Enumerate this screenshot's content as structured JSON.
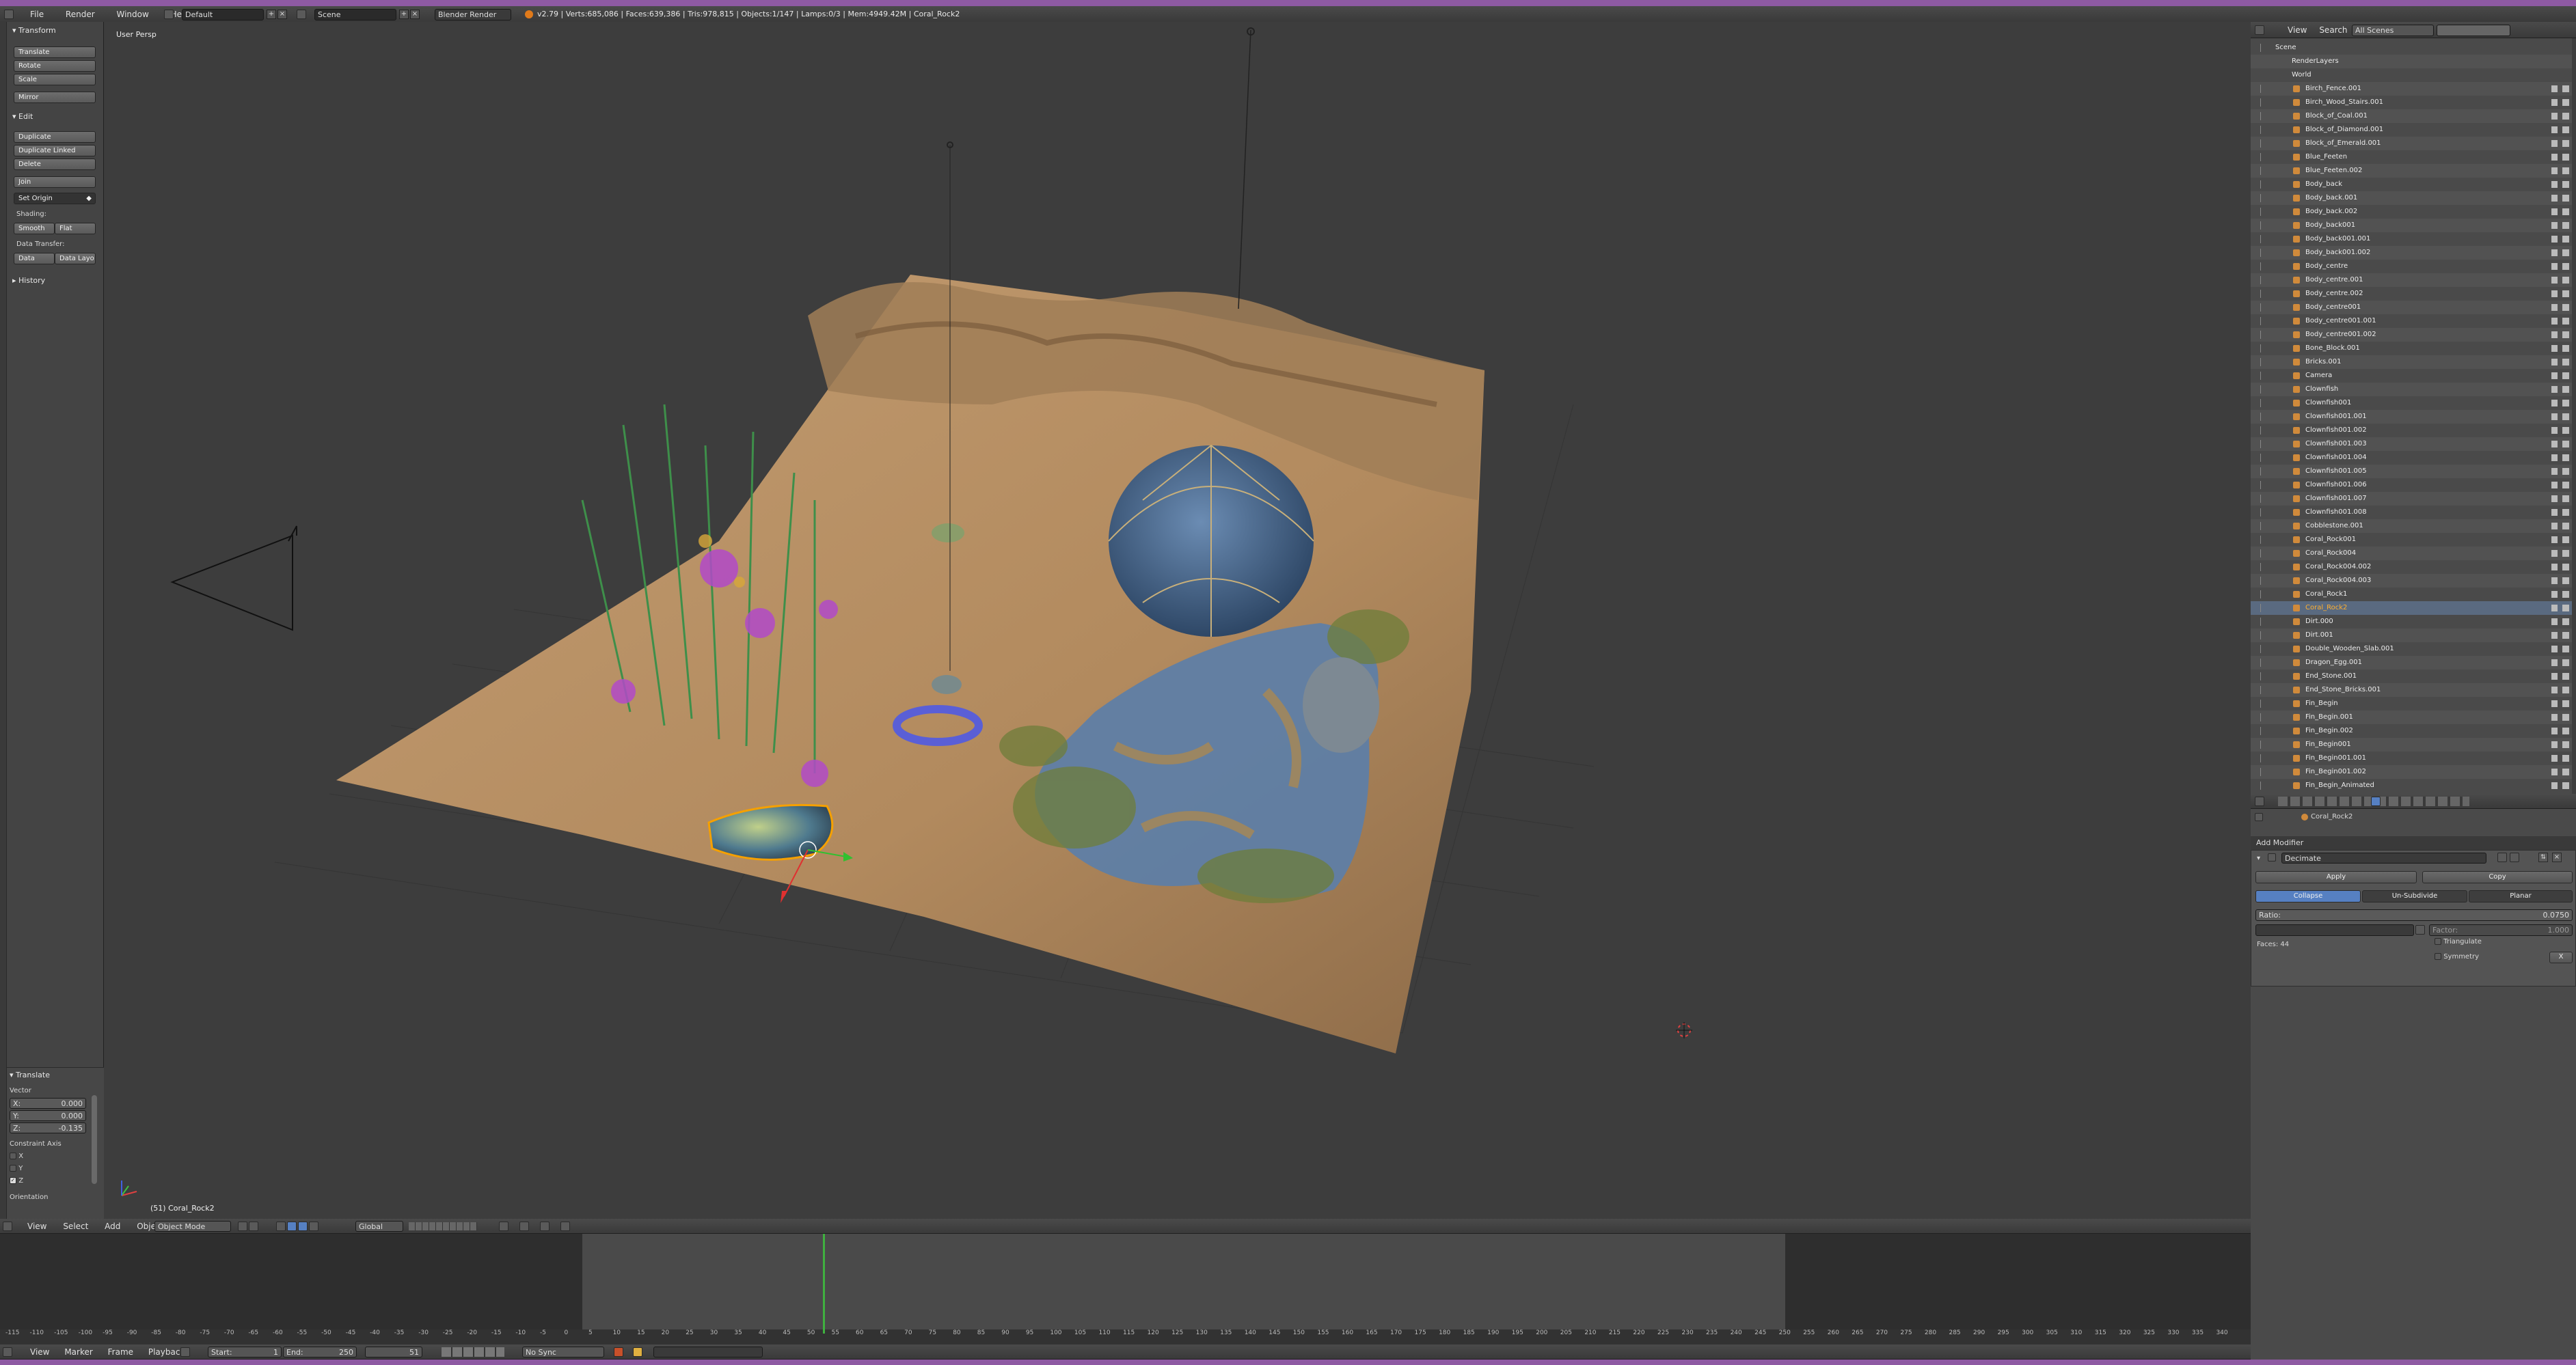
{
  "colors": {
    "accent_blue": "#5680c2",
    "purple_border": "#8e5aa3",
    "selected_orange": "#f5a000",
    "frame_green": "#3fb03f"
  },
  "topbar": {
    "menus": [
      "File",
      "Render",
      "Window",
      "Help"
    ],
    "layout": "Default",
    "scene": "Scene",
    "engine": "Blender Render",
    "stats": "v2.79 | Verts:685,086 | Faces:639,386 | Tris:978,815 | Objects:1/147 | Lamps:0/3 | Mem:4949.42M | Coral_Rock2"
  },
  "toolshelf": {
    "transform_title": "Transform",
    "transform_buttons": [
      "Translate",
      "Rotate",
      "Scale",
      "Mirror"
    ],
    "edit_title": "Edit",
    "edit_buttons": [
      "Duplicate",
      "Duplicate Linked",
      "Delete",
      "Join"
    ],
    "set_origin": "Set Origin",
    "shading_title": "Shading:",
    "shading_buttons": [
      "Smooth",
      "Flat"
    ],
    "data_transfer_title": "Data Transfer:",
    "data_transfer_buttons": [
      "Data",
      "Data Layo"
    ],
    "history_title": "History"
  },
  "operator_panel": {
    "title": "Translate",
    "vector_label": "Vector",
    "x": "X:",
    "x_val": "0.000",
    "y": "Y:",
    "y_val": "0.000",
    "z": "Z:",
    "z_val": "-0.135",
    "constraint_title": "Constraint Axis",
    "axes": [
      "X",
      "Y",
      "Z"
    ],
    "orientation_label": "Orientation"
  },
  "viewport": {
    "view_name": "User Persp",
    "object_label": "(51) Coral_Rock2"
  },
  "view3d_header": {
    "menus": [
      "View",
      "Select",
      "Add",
      "Object"
    ],
    "mode": "Object Mode",
    "orientation": "Global"
  },
  "outliner": {
    "menus": [
      "View",
      "Search"
    ],
    "scenes_dropdown": "All Scenes",
    "root": "Scene",
    "top_items": [
      "RenderLayers",
      "World"
    ],
    "items": [
      "Birch_Fence.001",
      "Birch_Wood_Stairs.001",
      "Block_of_Coal.001",
      "Block_of_Diamond.001",
      "Block_of_Emerald.001",
      "Blue_Feeten",
      "Blue_Feeten.002",
      "Body_back",
      "Body_back.001",
      "Body_back.002",
      "Body_back001",
      "Body_back001.001",
      "Body_back001.002",
      "Body_centre",
      "Body_centre.001",
      "Body_centre.002",
      "Body_centre001",
      "Body_centre001.001",
      "Body_centre001.002",
      "Bone_Block.001",
      "Bricks.001",
      "Camera",
      "Clownfish",
      "Clownfish001",
      "Clownfish001.001",
      "Clownfish001.002",
      "Clownfish001.003",
      "Clownfish001.004",
      "Clownfish001.005",
      "Clownfish001.006",
      "Clownfish001.007",
      "Clownfish001.008",
      "Cobblestone.001",
      "Coral_Rock001",
      "Coral_Rock004",
      "Coral_Rock004.002",
      "Coral_Rock004.003",
      "Coral_Rock1",
      "Coral_Rock2",
      "Dirt.000",
      "Dirt.001",
      "Double_Wooden_Slab.001",
      "Dragon_Egg.001",
      "End_Stone.001",
      "End_Stone_Bricks.001",
      "Fin_Begin",
      "Fin_Begin.001",
      "Fin_Begin.002",
      "Fin_Begin001",
      "Fin_Begin001.001",
      "Fin_Begin001.002",
      "Fin_Begin_Animated"
    ],
    "selected_item": "Coral_Rock2"
  },
  "properties": {
    "object_name": "Coral_Rock2",
    "add_modifier": "Add Modifier",
    "modifier_name": "Decimate",
    "apply": "Apply",
    "copy": "Copy",
    "tabs": [
      "Collapse",
      "Un-Subdivide",
      "Planar"
    ],
    "active_tab": "Collapse",
    "ratio_label": "Ratio:",
    "ratio_value": "0.0750",
    "factor_label": "Factor:",
    "factor_value": "1.000",
    "faces_label": "Faces: 44",
    "triangulate": "Triangulate",
    "symmetry": "Symmetry",
    "symmetry_axis": "X"
  },
  "timeline": {
    "ticks": [
      "-115",
      "-110",
      "-105",
      "-100",
      "-95",
      "-90",
      "-85",
      "-80",
      "-75",
      "-70",
      "-65",
      "-60",
      "-55",
      "-50",
      "-45",
      "-40",
      "-35",
      "-30",
      "-25",
      "-20",
      "-15",
      "-10",
      "-5",
      "0",
      "5",
      "10",
      "15",
      "20",
      "25",
      "30",
      "35",
      "40",
      "45",
      "50",
      "55",
      "60",
      "65",
      "70",
      "75",
      "80",
      "85",
      "90",
      "95",
      "100",
      "105",
      "110",
      "115",
      "120",
      "125",
      "130",
      "135",
      "140",
      "145",
      "150",
      "155",
      "160",
      "165",
      "170",
      "175",
      "180",
      "185",
      "190",
      "195",
      "200",
      "205",
      "210",
      "215",
      "220",
      "225",
      "230",
      "235",
      "240",
      "245",
      "250",
      "255",
      "260",
      "265",
      "270",
      "275",
      "280",
      "285",
      "290",
      "295",
      "300",
      "305",
      "310",
      "315",
      "320",
      "325",
      "330",
      "335",
      "340"
    ],
    "current_frame": 51,
    "range_start": 1,
    "range_end": 250,
    "menus": [
      "View",
      "Marker",
      "Frame",
      "Playback"
    ],
    "start_label": "Start:",
    "start_val": "1",
    "end_label": "End:",
    "end_val": "250",
    "frame_val": "51",
    "sync": "No Sync"
  }
}
